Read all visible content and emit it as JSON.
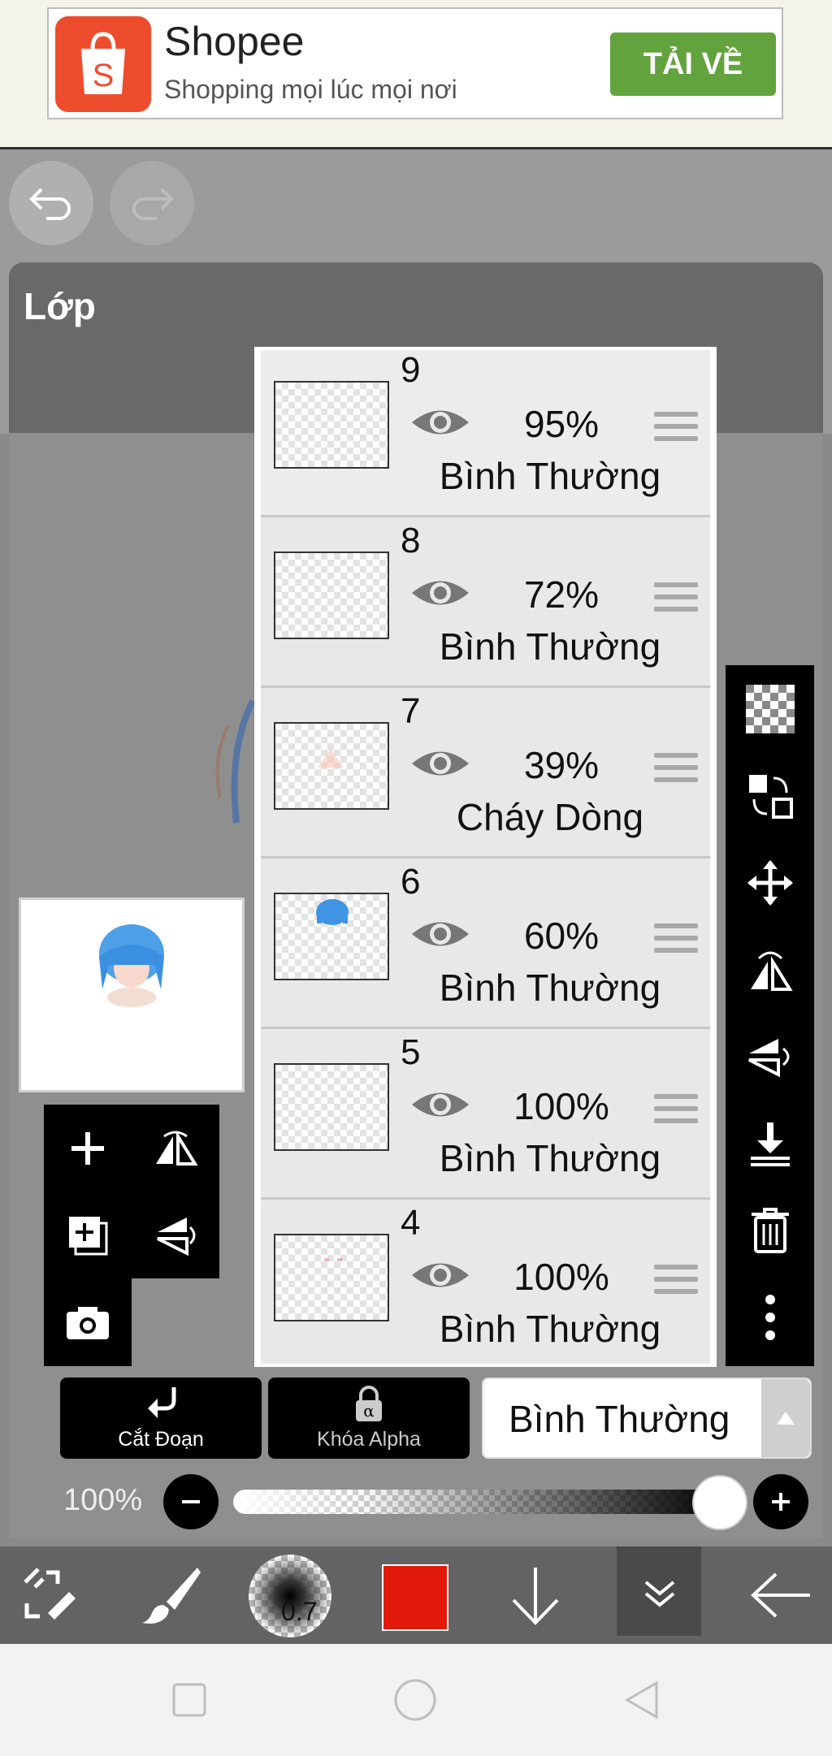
{
  "ad": {
    "title": "Shopee",
    "subtitle": "Shopping mọi lúc mọi nơi",
    "cta": "TẢI VỀ",
    "logo_letter": "S"
  },
  "panel": {
    "title": "Lớp"
  },
  "layers": [
    {
      "number": "9",
      "opacity": "95%",
      "mode": "Bình Thường"
    },
    {
      "number": "8",
      "opacity": "72%",
      "mode": "Bình Thường"
    },
    {
      "number": "7",
      "opacity": "39%",
      "mode": "Cháy Dòng"
    },
    {
      "number": "6",
      "opacity": "60%",
      "mode": "Bình Thường"
    },
    {
      "number": "5",
      "opacity": "100%",
      "mode": "Bình Thường"
    },
    {
      "number": "4",
      "opacity": "100%",
      "mode": "Bình Thường"
    }
  ],
  "controls": {
    "clip_label": "Cắt Đoạn",
    "alpha_lock_label": "Khóa Alpha",
    "blend_mode": "Bình Thường",
    "opacity_label": "100%",
    "opacity_value": 1.0
  },
  "toolbar": {
    "brush_size": "0.7",
    "color": "#e21a0b"
  },
  "colors": {
    "ad_cta": "#63a33e",
    "shopee": "#ee4d2d",
    "panel_header": "#696969"
  }
}
